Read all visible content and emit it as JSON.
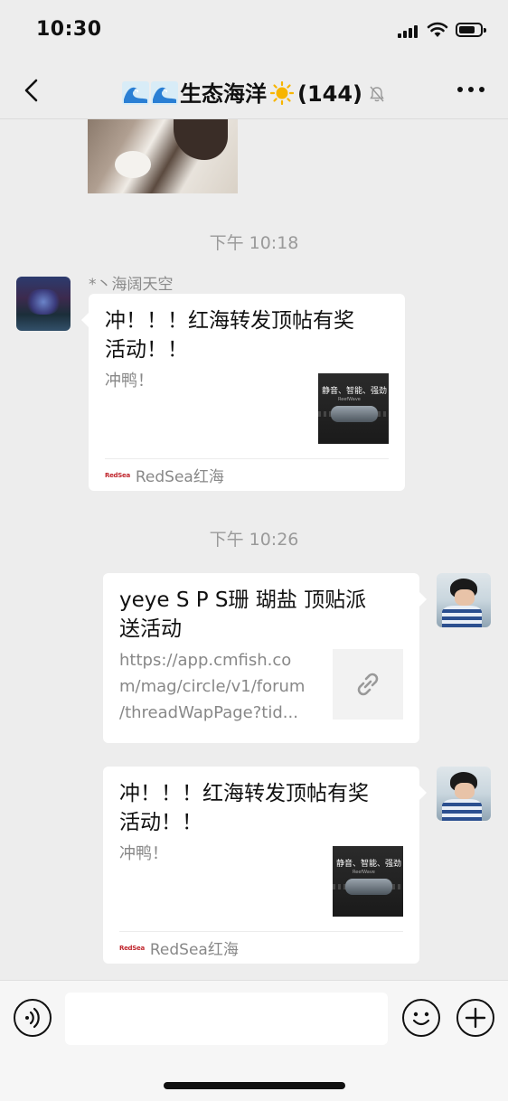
{
  "status_bar": {
    "time": "10:30",
    "signal": "cellular-signal-icon",
    "wifi": "wifi-icon",
    "battery": "battery-icon"
  },
  "header": {
    "back_icon": "chevron-left-icon",
    "title_emoji_prefix": "wave-emoji-icons",
    "title_name": "生态海洋",
    "title_emoji_suffix": "sun-emoji-icon",
    "title_count": "(144)",
    "mute_icon": "muted-bell-icon",
    "more_icon": "more-dots-icon"
  },
  "messages": [
    {
      "type": "image",
      "side": "left",
      "description_icon": "cat-photo-image"
    },
    {
      "type": "timestamp",
      "text": "下午 10:18"
    },
    {
      "type": "card",
      "side": "left",
      "sender": "*丶海阔天空",
      "title_line1": "冲！！！红海转发顶帖有奖",
      "title_line2": "活动！！",
      "desc": "冲鸭！",
      "thumb_text": "静音、智能、强劲",
      "thumb_subtext": "ReefWave",
      "source_logo": "RedSea",
      "source": "RedSea红海"
    },
    {
      "type": "timestamp",
      "text": "下午 10:26"
    },
    {
      "type": "link",
      "side": "right",
      "title_line1": "yeye S P S珊 瑚盐 顶贴派",
      "title_line2": "送活动",
      "url_line1": "https://app.cmfish.co",
      "url_line2": "m/mag/circle/v1/forum",
      "url_line3": "/threadWapPage?tid...",
      "thumb_icon": "link-icon"
    },
    {
      "type": "card",
      "side": "right",
      "title_line1": "冲！！！红海转发顶帖有奖",
      "title_line2": "活动！！",
      "desc": "冲鸭！",
      "thumb_text": "静音、智能、强劲",
      "thumb_subtext": "ReefWave",
      "source_logo": "RedSea",
      "source": "RedSea红海"
    }
  ],
  "input_bar": {
    "voice_icon": "voice-icon",
    "text_value": "",
    "emoji_icon": "emoji-icon",
    "plus_icon": "plus-icon"
  },
  "colors": {
    "background": "#ededed",
    "bubble": "#ffffff",
    "brand_red": "#c0262d",
    "muted_text": "#888888"
  }
}
